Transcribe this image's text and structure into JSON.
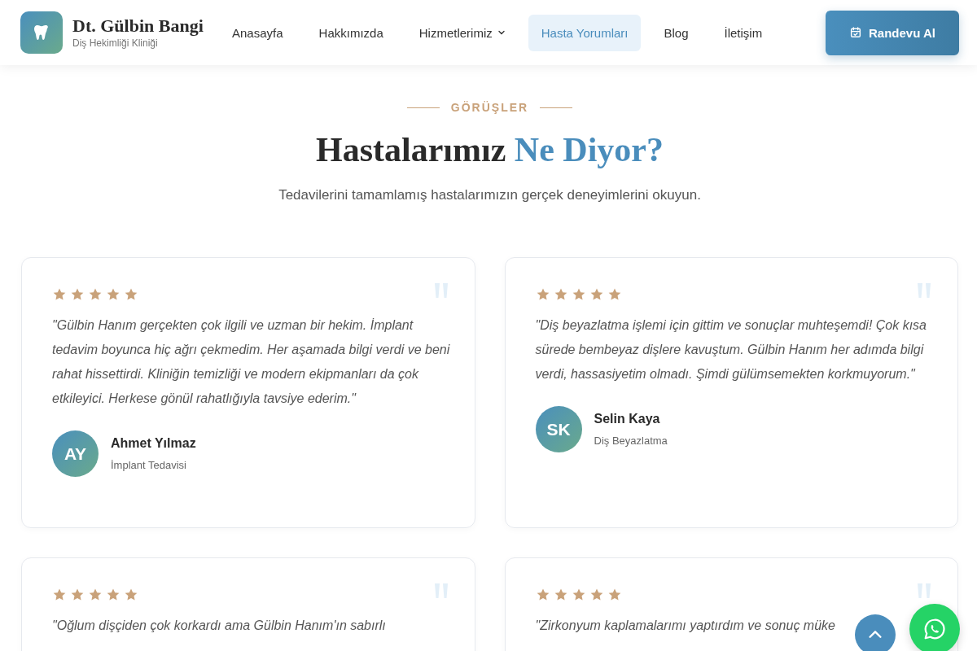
{
  "header": {
    "brand": {
      "name": "Dt. Gülbin Bangi",
      "subtitle": "Diş Hekimliği Kliniği"
    },
    "nav": [
      {
        "label": "Anasayfa",
        "kind": "link",
        "selected": false
      },
      {
        "label": "Hakkımızda",
        "kind": "link",
        "selected": false
      },
      {
        "label": "Hizmetlerimiz",
        "kind": "dropdown",
        "selected": false
      },
      {
        "label": "Hasta Yorumları",
        "kind": "link",
        "selected": true
      },
      {
        "label": "Blog",
        "kind": "link",
        "selected": false
      },
      {
        "label": "İletişim",
        "kind": "link",
        "selected": false
      }
    ],
    "cta": "Randevu Al"
  },
  "section": {
    "eyebrow": "GÖRÜŞLER",
    "title": "Hastalarımız",
    "title_accent": "Ne Diyor?",
    "subtitle": "Tedavilerini tamamlamış hastalarımızın gerçek deneyimlerini okuyun."
  },
  "reviews": [
    {
      "stars": 5,
      "text": "\"Gülbin Hanım gerçekten çok ilgili ve uzman bir hekim. İmplant tedavim boyunca hiç ağrı çekmedim. Her aşamada bilgi verdi ve beni rahat hissettirdi. Kliniğin temizliği ve modern ekipmanları da çok etkileyici. Herkese gönül rahatlığıyla tavsiye ederim.\"",
      "initials": "AY",
      "name": "Ahmet Yılmaz",
      "treatment": "İmplant Tedavisi"
    },
    {
      "stars": 5,
      "text": "\"Diş beyazlatma işlemi için gittim ve sonuçlar muhteşemdi! Çok kısa sürede bembeyaz dişlere kavuştum. Gülbin Hanım her adımda bilgi verdi, hassasiyetim olmadı. Şimdi gülümsemekten korkmuyorum.\"",
      "initials": "SK",
      "name": "Selin Kaya",
      "treatment": "Diş Beyazlatma"
    },
    {
      "stars": 5,
      "text": "\"Oğlum dişçiden çok korkardı ama Gülbin Hanım'ın sabırlı"
    },
    {
      "stars": 5,
      "text": "\"Zirkonyum kaplamalarımı yaptırdım ve sonuç müke"
    }
  ]
}
